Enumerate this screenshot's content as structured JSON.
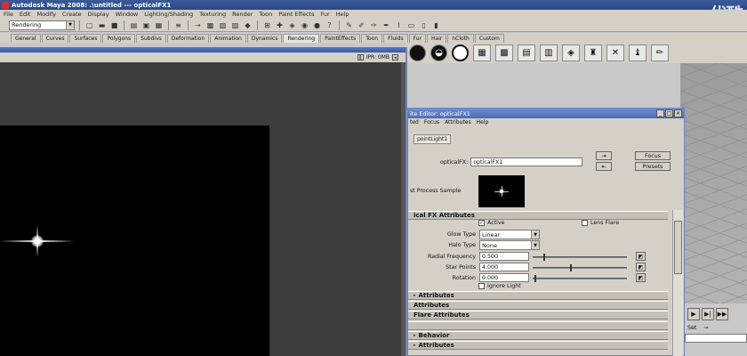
{
  "app": {
    "title": "Autodesk Maya 2008: .\\untitled   ---   opticalFX1",
    "watermark": "优酷"
  },
  "menubar": [
    "File",
    "Edit",
    "Modify",
    "Create",
    "Display",
    "Window",
    "Lighting/Shading",
    "Texturing",
    "Render",
    "Toon",
    "Paint Effects",
    "Fur",
    "Help"
  ],
  "statusline": {
    "menu_set": "Rendering"
  },
  "shelf_tabs": [
    "General",
    "Curves",
    "Surfaces",
    "Polygons",
    "Subdivs",
    "Deformation",
    "Animation",
    "Dynamics",
    "Rendering",
    "PaintEffects",
    "Toon",
    "Fluids",
    "Fur",
    "Hair",
    "nCloth",
    "Custom"
  ],
  "shelf_active": "Rendering",
  "render_view": {
    "toolbar_text": "IPR: 0MB"
  },
  "attribute_editor": {
    "title": "ite Editor: opticalFX1",
    "menu": [
      "ted",
      "Focus",
      "Attributes",
      "Help"
    ],
    "tab": "pointLight1",
    "node_label": "opticalFX:",
    "node_value": "opticalFX1",
    "focus_btn": "Focus",
    "presets_btn": "Presets",
    "sample_label": "st Process Sample",
    "section_main": "ical FX Attributes",
    "active_label": "Active",
    "lens_flare_label": "Lens Flare",
    "glow_type_label": "Glow Type",
    "glow_type_value": "Linear",
    "halo_type_label": "Halo Type",
    "halo_type_value": "None",
    "radial_freq_label": "Radial Frequency",
    "radial_freq_value": "0.500",
    "star_points_label": "Star Points",
    "star_points_value": "4.000",
    "rotation_label": "Rotation",
    "rotation_value": "0.000",
    "ignore_light_label": "Ignore Light",
    "collapsed_sections": [
      " Attributes",
      "Attributes",
      "Flare Attributes",
      "",
      "Behavior",
      " Attributes"
    ]
  },
  "timeline": {
    "set_label": "Set"
  }
}
